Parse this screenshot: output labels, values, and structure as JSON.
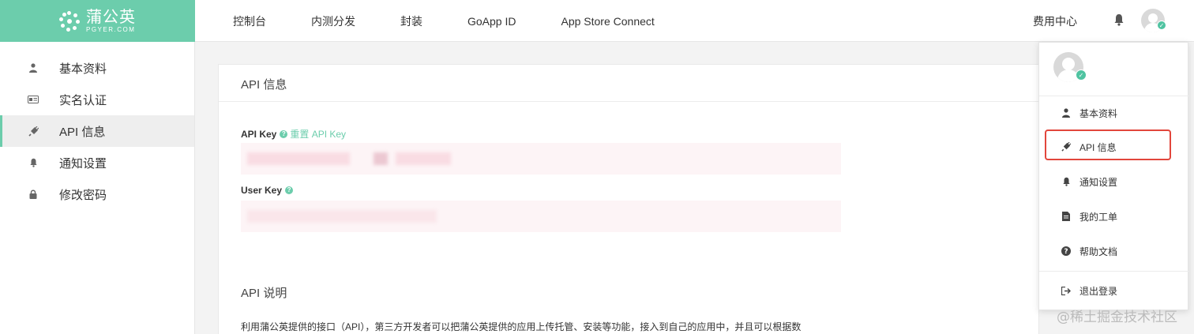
{
  "brand": {
    "name_cn": "蒲公英",
    "name_en": "PGYER.COM",
    "color": "#6ccdac"
  },
  "nav": {
    "items": [
      "控制台",
      "内测分发",
      "封装",
      "GoApp ID",
      "App Store Connect"
    ]
  },
  "header": {
    "fee_center": "费用中心"
  },
  "sidebar": {
    "items": [
      {
        "label": "基本资料",
        "icon": "user-icon"
      },
      {
        "label": "实名认证",
        "icon": "id-card-icon"
      },
      {
        "label": "API 信息",
        "icon": "plug-icon",
        "active": true
      },
      {
        "label": "通知设置",
        "icon": "bell-icon"
      },
      {
        "label": "修改密码",
        "icon": "lock-icon"
      }
    ]
  },
  "panel": {
    "title": "API 信息",
    "api_key_label": "API Key",
    "reset_label": "重置 API Key",
    "user_key_label": "User Key",
    "section_title": "API 说明",
    "description": "利用蒲公英提供的接口（API），第三方开发者可以把蒲公英提供的应用上传托管、安装等功能，接入到自己的应用中，并且可以根据数"
  },
  "dropdown": {
    "items": [
      {
        "label": "基本资料",
        "icon": "user-icon"
      },
      {
        "label": "API 信息",
        "icon": "plug-icon",
        "highlighted": true
      },
      {
        "label": "通知设置",
        "icon": "bell-icon"
      },
      {
        "label": "我的工单",
        "icon": "file-icon"
      },
      {
        "label": "帮助文档",
        "icon": "question-circle-icon"
      },
      {
        "label": "退出登录",
        "icon": "sign-out-icon"
      }
    ]
  },
  "watermark": "@稀土掘金技术社区",
  "colors": {
    "highlight_border": "#e2463c",
    "badge": "#4fc3a1"
  }
}
